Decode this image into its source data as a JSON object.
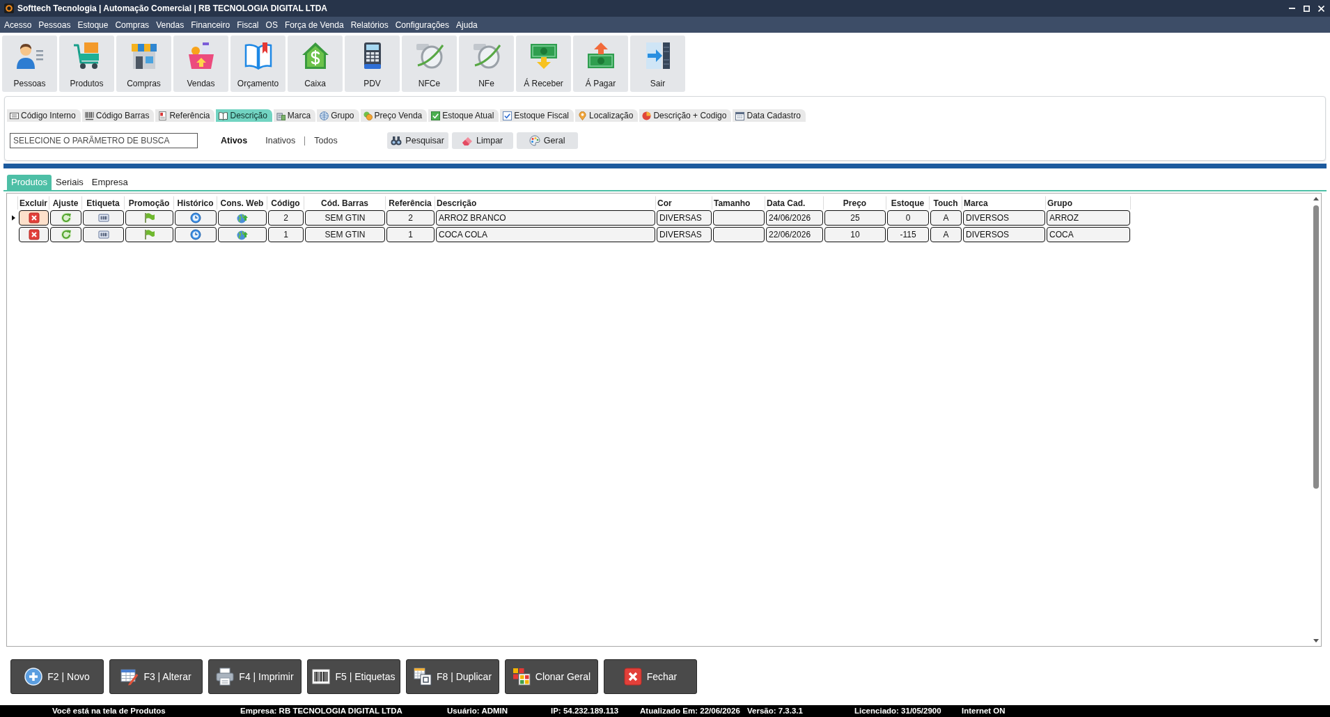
{
  "window": {
    "title": "Softtech Tecnologia | Automação Comercial | RB TECNOLOGIA DIGITAL LTDA"
  },
  "menu": [
    "Acesso",
    "Pessoas",
    "Estoque",
    "Compras",
    "Vendas",
    "Financeiro",
    "Fiscal",
    "OS",
    "Força de Venda",
    "Relatórios",
    "Configurações",
    "Ajuda"
  ],
  "toolbar": [
    "Pessoas",
    "Produtos",
    "Compras",
    "Vendas",
    "Orçamento",
    "Caixa",
    "PDV",
    "NFCe",
    "NFe",
    "Á Receber",
    "Á Pagar",
    "Sair"
  ],
  "search_by": [
    {
      "label": "Código Interno",
      "selected": false
    },
    {
      "label": "Código Barras",
      "selected": false
    },
    {
      "label": "Referência",
      "selected": false
    },
    {
      "label": "Descrição",
      "selected": true
    },
    {
      "label": "Marca",
      "selected": false
    },
    {
      "label": "Grupo",
      "selected": false
    },
    {
      "label": "Preço Venda",
      "selected": false
    },
    {
      "label": "Estoque Atual",
      "selected": false
    },
    {
      "label": "Estoque Fiscal",
      "selected": false
    },
    {
      "label": "Localização",
      "selected": false
    },
    {
      "label": "Descrição + Codigo",
      "selected": false
    },
    {
      "label": "Data Cadastro",
      "selected": false
    }
  ],
  "search": {
    "placeholder": "SELECIONE O PARÂMETRO DE BUSCA"
  },
  "status_filter": [
    {
      "label": "Ativos",
      "selected": true
    },
    {
      "label": "Inativos",
      "selected": false
    },
    {
      "label": "Todos",
      "selected": false
    }
  ],
  "actions": [
    "Pesquisar",
    "Limpar",
    "Geral"
  ],
  "tabs": [
    {
      "label": "Produtos",
      "selected": true
    },
    {
      "label": "Seriais",
      "selected": false
    },
    {
      "label": "Empresa",
      "selected": false
    }
  ],
  "table": {
    "columns": [
      {
        "label": "Excluir",
        "kind": "action"
      },
      {
        "label": "Ajuste",
        "kind": "action"
      },
      {
        "label": "Etiqueta",
        "kind": "action"
      },
      {
        "label": "Promoção",
        "kind": "action"
      },
      {
        "label": "Histórico",
        "kind": "action"
      },
      {
        "label": "Cons. Web",
        "kind": "action"
      },
      {
        "label": "Código",
        "kind": "text"
      },
      {
        "label": "Cód. Barras",
        "kind": "text"
      },
      {
        "label": "Referência",
        "kind": "text"
      },
      {
        "label": "Descrição",
        "kind": "text"
      },
      {
        "label": "Cor",
        "kind": "text"
      },
      {
        "label": "Tamanho",
        "kind": "text"
      },
      {
        "label": "Data Cad.",
        "kind": "text"
      },
      {
        "label": "Preço",
        "kind": "text"
      },
      {
        "label": "Estoque",
        "kind": "text"
      },
      {
        "label": "Touch",
        "kind": "text"
      },
      {
        "label": "Marca",
        "kind": "text"
      },
      {
        "label": "Grupo",
        "kind": "text"
      }
    ],
    "rows": [
      {
        "selected": true,
        "codigo": "2",
        "cod_barras": "SEM GTIN",
        "referencia": "2",
        "descricao": "ARROZ BRANCO",
        "cor": "DIVERSAS",
        "data_cad": "24/06/2026",
        "preco": "25",
        "estoque": "0",
        "touch": "A",
        "marca": "DIVERSOS",
        "grupo": "ARROZ"
      },
      {
        "selected": false,
        "codigo": "1",
        "cod_barras": "SEM GTIN",
        "referencia": "1",
        "descricao": "COCA COLA",
        "cor": "DIVERSAS",
        "data_cad": "22/06/2026",
        "preco": "10",
        "estoque": "-115",
        "touch": "A",
        "marca": "DIVERSOS",
        "grupo": "COCA"
      }
    ]
  },
  "bottom_buttons": [
    "F2 | Novo",
    "F3 | Alterar",
    "F4 | Imprimir",
    "F5 | Etiquetas",
    "F8 | Duplicar",
    "Clonar Geral",
    "Fechar"
  ],
  "status_bar": [
    "Você está na tela de Produtos",
    "Empresa: RB TECNOLOGIA DIGITAL LTDA",
    "Usuário: ADMIN",
    "IP: 54.232.189.113",
    "Atualizado Em: 22/06/2026",
    "Versão: 7.3.3.1",
    "Licenciado: 31/05/2900",
    "Internet ON"
  ]
}
